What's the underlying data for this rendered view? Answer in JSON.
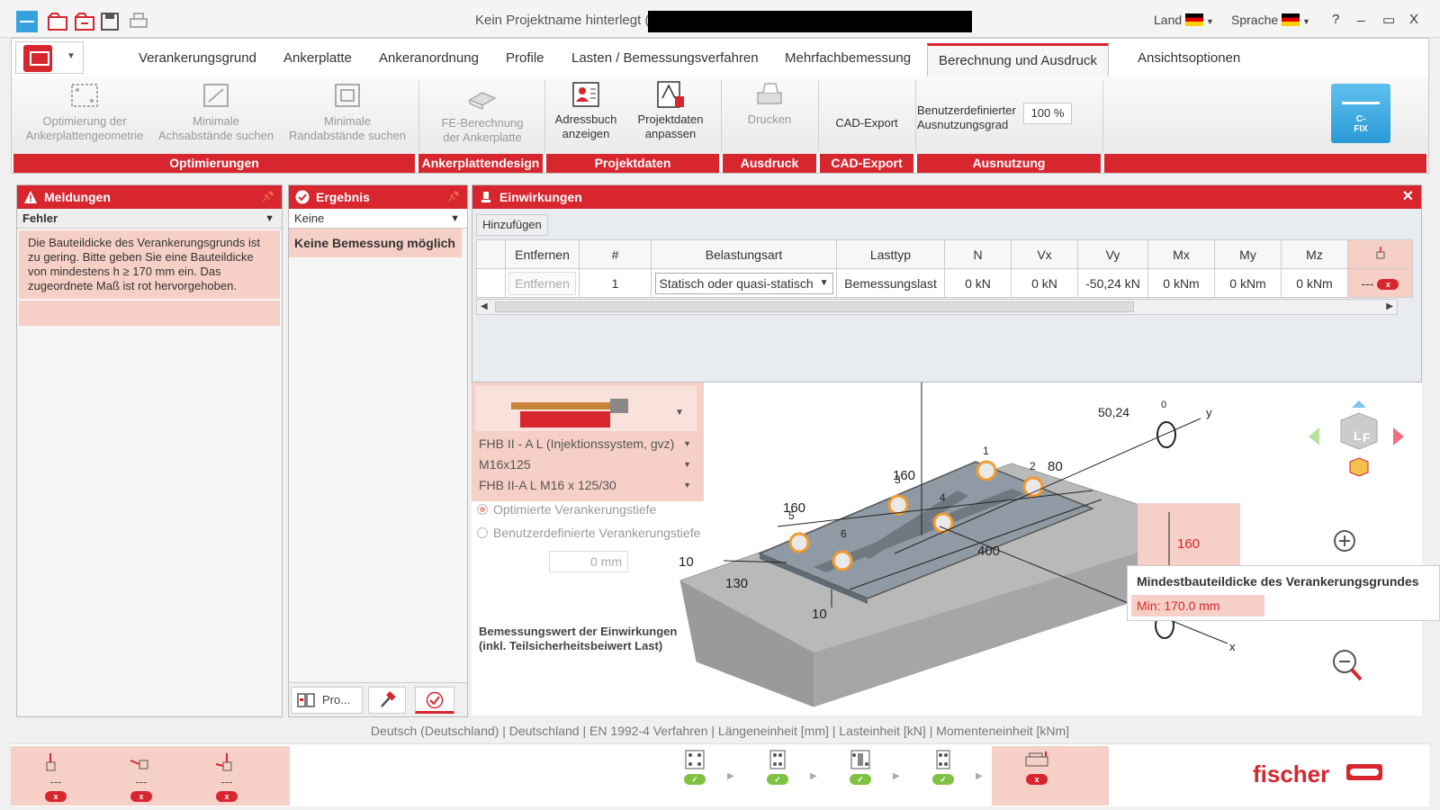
{
  "titlebar": {
    "title": "Kein Projektname hinterlegt (",
    "land_label": "Land",
    "sprache_label": "Sprache",
    "help": "?",
    "minimize": "_",
    "maximize": "▭",
    "close": "X"
  },
  "tabs": [
    {
      "label": "Verankerungsgrund"
    },
    {
      "label": "Ankerplatte"
    },
    {
      "label": "Ankeranordnung"
    },
    {
      "label": "Profile"
    },
    {
      "label": "Lasten / Bemessungsverfahren"
    },
    {
      "label": "Mehrfachbemessung"
    },
    {
      "label": "Berechnung und Ausdruck",
      "active": true
    },
    {
      "label": "Ansichtsoptionen"
    }
  ],
  "ribbon": {
    "opt_geometry": [
      "Optimierung der",
      "Ankerplattengeometrie"
    ],
    "min_axis": [
      "Minimale",
      "Achsabstände suchen"
    ],
    "min_edge": [
      "Minimale",
      "Randabstände suchen"
    ],
    "fe_calc": [
      "FE-Berechnung",
      "der Ankerplatte"
    ],
    "address_book": [
      "Adressbuch",
      "anzeigen"
    ],
    "project_data": [
      "Projektdaten",
      "anpassen"
    ],
    "print": "Drucken",
    "cad_export": "CAD-Export",
    "utilization_label": [
      "Benutzerdefinierter",
      "Ausnutzungsgrad"
    ],
    "utilization_value": "100 %",
    "cfix_label": [
      "C-",
      "FIX"
    ],
    "groups": [
      "Optimierungen",
      "Ankerplattendesign",
      "Projektdaten",
      "Ausdruck",
      "CAD-Export",
      "Ausnutzung"
    ]
  },
  "messages": {
    "title": "Meldungen",
    "filter": "Fehler",
    "text": "Die Bauteildicke des Verankerungsgrunds ist zu gering. Bitte geben Sie eine Bauteildicke von mindestens h ≥ 170 mm ein. Das zugeordnete Maß ist rot hervorgehoben."
  },
  "result": {
    "title": "Ergebnis",
    "filter": "Keine",
    "text": "Keine Bemessung möglich",
    "btn_pro": "Pro..."
  },
  "actions": {
    "title": "Einwirkungen",
    "add": "Hinzufügen",
    "headers": [
      "Entfernen",
      "#",
      "Belastungsart",
      "Lasttyp",
      "N",
      "Vx",
      "Vy",
      "Mx",
      "My",
      "Mz"
    ],
    "row": {
      "remove": "Entfernen",
      "num": "1",
      "belastungsart": "Statisch oder quasi-statisch",
      "lasttyp": "Bemessungslast",
      "N": "0 kN",
      "Vx": "0 kN",
      "Vy": "-50,24 kN",
      "Mx": "0 kNm",
      "My": "0 kNm",
      "Mz": "0 kNm",
      "last": "---"
    }
  },
  "anchor": {
    "system": "FHB II - A L (Injektionssystem, gvz)",
    "size": "M16x125",
    "product": "FHB II-A L M16 x 125/30",
    "opt_depth": "Optimierte Verankerungstiefe",
    "user_depth": "Benutzerdefinierte Verankerungstiefe",
    "depth_value": "0 mm"
  },
  "view": {
    "note": [
      "Bemessungswert der Einwirkungen",
      "(inkl. Teilsicherheitsbeiwert Last)"
    ],
    "dims": {
      "d160a": "160",
      "d160b": "160",
      "d80": "80",
      "d400": "400",
      "d130": "130",
      "d10a": "10",
      "d10b": "10",
      "d160red": "160",
      "load": "50,24",
      "zero": "0",
      "y": "y",
      "x": "x",
      "a1": "1",
      "a2": "2",
      "a3": "3",
      "a4": "4",
      "a5": "5",
      "a6": "6"
    },
    "cube_labels": [
      "L",
      "F"
    ]
  },
  "tooltip": {
    "title": "Mindestbauteildicke des Verankerungsgrundes",
    "value": "Min: 170.0 mm"
  },
  "statusbar": "Deutsch (Deutschland) |   Deutschland |   EN 1992-4 Verfahren |   Längeneinheit [mm] |   Lasteinheit [kN] |   Momenteneinheit [kNm]",
  "bottomnav": {
    "dash": "---",
    "x": "x",
    "check": "✓"
  },
  "brand": "fischer",
  "colors": {
    "accent": "#d8262f",
    "highlight": "#f6d0c6",
    "ok": "#7dc242",
    "cfix": "#2a9ad6"
  }
}
